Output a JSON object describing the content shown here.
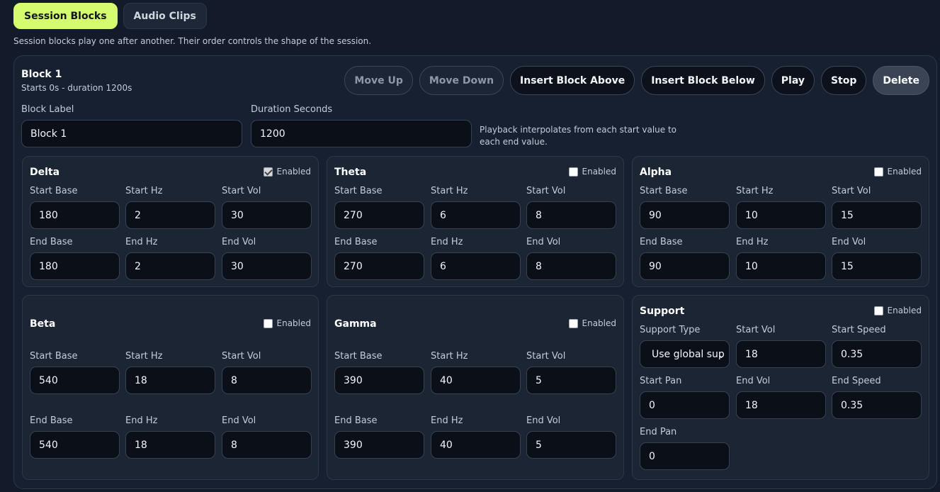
{
  "tabs": [
    "Session Blocks",
    "Audio Clips"
  ],
  "intro": "Session blocks play one after another. Their order controls the shape of the session.",
  "block": {
    "title": "Block 1",
    "subtitle": "Starts 0s - duration 1200s",
    "actions": [
      "Move Up",
      "Move Down",
      "Insert Block Above",
      "Insert Block Below",
      "Play",
      "Stop",
      "Delete"
    ],
    "label_field": {
      "label": "Block Label",
      "value": "Block 1"
    },
    "duration_field": {
      "label": "Duration Seconds",
      "value": "1200"
    },
    "hint": "Playback interpolates from each start value to each end value."
  },
  "enabled_label": "Enabled",
  "field_labels": {
    "start_base": "Start Base",
    "start_hz": "Start Hz",
    "start_vol": "Start Vol",
    "end_base": "End Base",
    "end_hz": "End Hz",
    "end_vol": "End Vol"
  },
  "bands": {
    "delta": {
      "title": "Delta",
      "enabled": true,
      "start_base": "180",
      "start_hz": "2",
      "start_vol": "30",
      "end_base": "180",
      "end_hz": "2",
      "end_vol": "30"
    },
    "theta": {
      "title": "Theta",
      "enabled": false,
      "start_base": "270",
      "start_hz": "6",
      "start_vol": "8",
      "end_base": "270",
      "end_hz": "6",
      "end_vol": "8"
    },
    "alpha": {
      "title": "Alpha",
      "enabled": false,
      "start_base": "90",
      "start_hz": "10",
      "start_vol": "15",
      "end_base": "90",
      "end_hz": "10",
      "end_vol": "15"
    },
    "beta": {
      "title": "Beta",
      "enabled": false,
      "start_base": "540",
      "start_hz": "18",
      "start_vol": "8",
      "end_base": "540",
      "end_hz": "18",
      "end_vol": "8"
    },
    "gamma": {
      "title": "Gamma",
      "enabled": false,
      "start_base": "390",
      "start_hz": "40",
      "start_vol": "5",
      "end_base": "390",
      "end_hz": "40",
      "end_vol": "5"
    }
  },
  "support": {
    "title": "Support",
    "enabled": false,
    "labels": {
      "support_type": "Support Type",
      "start_vol": "Start Vol",
      "start_speed": "Start Speed",
      "start_pan": "Start Pan",
      "end_vol": "End Vol",
      "end_speed": "End Speed",
      "end_pan": "End Pan"
    },
    "support_type": "Use global sup",
    "start_vol": "18",
    "start_speed": "0.35",
    "start_pan": "0",
    "end_vol": "18",
    "end_speed": "0.35",
    "end_pan": "0"
  }
}
